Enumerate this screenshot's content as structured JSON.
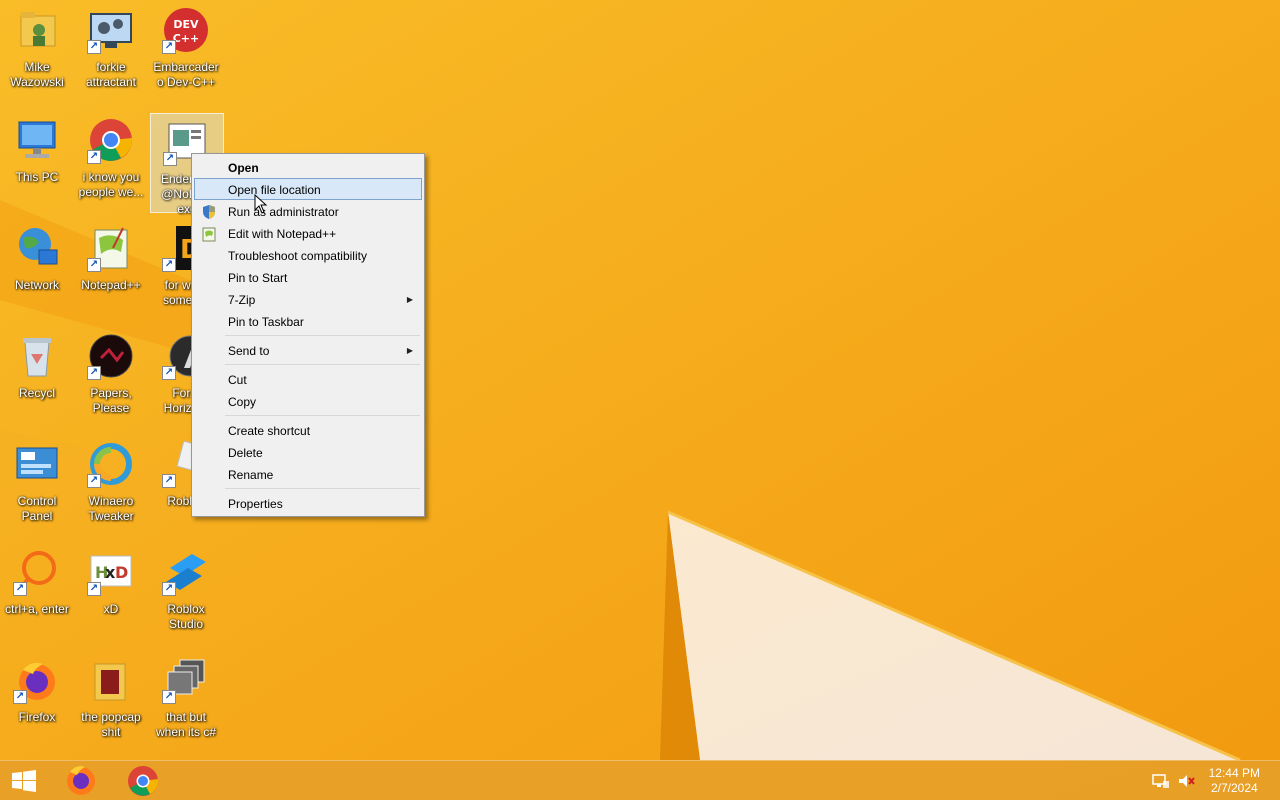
{
  "desktop": {
    "icons": [
      {
        "label": "Mike Wazowski",
        "icon": "folder-user-icon"
      },
      {
        "label": "forkie attractant",
        "icon": "settings-monitor-icon"
      },
      {
        "label": "Embarcadero Dev-C++",
        "icon": "devcpp-icon"
      },
      {
        "label": "This PC",
        "icon": "computer-icon"
      },
      {
        "label": "i know you people we...",
        "icon": "chrome-icon"
      },
      {
        "label": "Enderm... @NoEs... exe",
        "icon": "app-window-icon"
      },
      {
        "label": "Network",
        "icon": "network-globe-icon"
      },
      {
        "label": "Notepad++",
        "icon": "notepadpp-icon"
      },
      {
        "label": "for wh... some r...",
        "icon": "dark-app-icon"
      },
      {
        "label": "Recycl",
        "icon": "recycle-bin-icon"
      },
      {
        "label": "Papers, Please",
        "icon": "papers-please-icon"
      },
      {
        "label": "For... Horizo...",
        "icon": "forza-icon"
      },
      {
        "label": "Control Panel",
        "icon": "control-panel-icon"
      },
      {
        "label": "Winaero Tweaker",
        "icon": "winaero-icon"
      },
      {
        "label": "Roblox",
        "icon": "roblox-icon"
      },
      {
        "label": "ctrl+a, enter",
        "icon": "orange-ring-icon"
      },
      {
        "label": "xD",
        "icon": "hxd-icon"
      },
      {
        "label": "Roblox Studio",
        "icon": "roblox-studio-icon"
      },
      {
        "label": "Firefox",
        "icon": "firefox-icon"
      },
      {
        "label": "the popcap shit",
        "icon": "folder-icon"
      },
      {
        "label": "that but when its c#",
        "icon": "windows-stack-icon"
      }
    ]
  },
  "context_menu": {
    "items": [
      {
        "label": "Open"
      },
      {
        "label": "Open file location"
      },
      {
        "label": "Run as administrator"
      },
      {
        "label": "Edit with Notepad++"
      },
      {
        "label": "Troubleshoot compatibility"
      },
      {
        "label": "Pin to Start"
      },
      {
        "label": "7-Zip"
      },
      {
        "label": "Pin to Taskbar"
      },
      {
        "label": "Send to"
      },
      {
        "label": "Cut"
      },
      {
        "label": "Copy"
      },
      {
        "label": "Create shortcut"
      },
      {
        "label": "Delete"
      },
      {
        "label": "Rename"
      },
      {
        "label": "Properties"
      }
    ]
  },
  "taskbar": {
    "clock_time": "12:44 PM",
    "clock_date": "2/7/2024"
  },
  "colors": {
    "wallpaper": "#f6a81a",
    "menu_highlight": "#d9e8f8"
  }
}
